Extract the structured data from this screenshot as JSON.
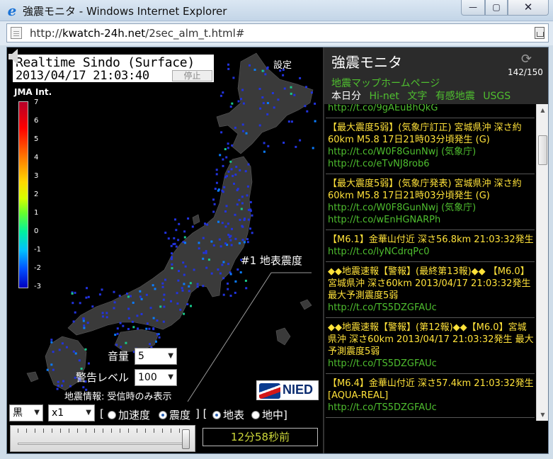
{
  "window": {
    "title": "強震モニタ - Windows Internet Explorer",
    "min": "—",
    "max": "▢",
    "close": "✕"
  },
  "address": {
    "scheme": "http://",
    "host": "kwatch-24h.net",
    "path": "/2sec_alm_t.html#"
  },
  "map": {
    "title_line1": "Realtime Sindo (Surface)",
    "title_line2": "2013/04/17 21:03:40",
    "stop_label": "停止",
    "settings_label": "設定",
    "scale_label": "JMA Int.",
    "scale_ticks": [
      "7",
      "6",
      "5",
      "4",
      "3",
      "2",
      "1",
      "0",
      "-1",
      "-2",
      "-3"
    ],
    "station_label": "#1 地表震度",
    "volume_label": "音量",
    "volume_value": "5",
    "alert_label": "警告レベル",
    "alert_value": "100",
    "quake_info": "地震情報: 受信時のみ表示",
    "logo_text": "NIED"
  },
  "controls": {
    "color_value": "黒",
    "speed_value": "x1",
    "radio_accel": "加速度",
    "radio_intensity": "震度",
    "radio_surface": "地表",
    "radio_underground": "地中",
    "elapsed": "12分58秒前"
  },
  "panel": {
    "title": "強震モニタ",
    "count": "142/150",
    "home_link": "地震マップホームページ",
    "nav": [
      "本日分",
      "Hi-net",
      "文字",
      "有感地震",
      "USGS"
    ],
    "tweets": [
      {
        "text": "",
        "links": [
          "http://t.co/9gAEuBhQkG"
        ]
      },
      {
        "text": "【最大震度5弱】(気象庁訂正) 宮城県沖 深さ約60km M5.8 17日21時03分頃発生 (G)",
        "links": [
          "http://t.co/W0F8GunNwj (気象庁)",
          "http://t.co/eTvNJ8rob6"
        ]
      },
      {
        "text": "【最大震度5弱】(気象庁発表) 宮城県沖 深さ約60km M5.8 17日21時03分頃発生 (G)",
        "links": [
          "http://t.co/W0F8GunNwj (気象庁)",
          "http://t.co/wEnHGNARPh"
        ]
      },
      {
        "text": "【M6.1】金華山付近 深さ56.8km 21:03:32発生",
        "links": [
          "http://t.co/lyNCdrqPc0"
        ]
      },
      {
        "text": "◆◆地震速報【警報】(最終第13報)◆◆ 【M6.0】宮城県沖 深さ60km 2013/04/17 21:03:32発生 最大予測震度5弱",
        "links": [
          "http://t.co/TS5DZGFAUc"
        ]
      },
      {
        "text": "◆◆地震速報【警報】(第12報)◆◆【M6.0】宮城県沖 深さ60km 2013/04/17 21:03:32発生 最大予測震度5弱",
        "links": [
          "http://t.co/TS5DZGFAUc"
        ]
      },
      {
        "text": "【M6.4】金華山付近 深さ57.4km 21:03:32発生 [AQUA-REAL]",
        "links": [
          "http://t.co/TS5DZGFAUc"
        ]
      }
    ]
  }
}
